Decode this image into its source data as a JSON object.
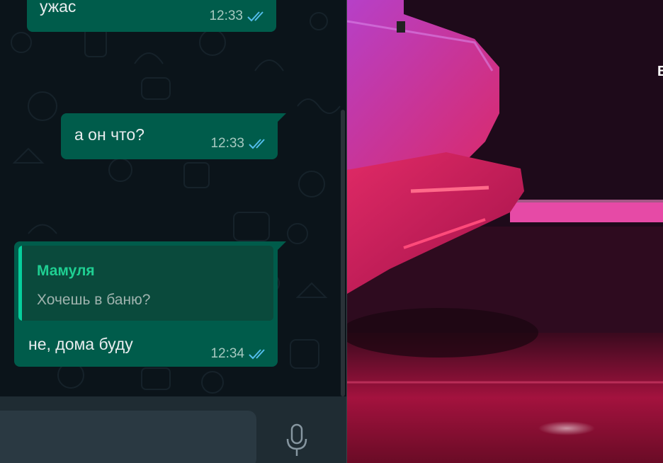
{
  "chat": {
    "messages": [
      {
        "text": "ужас",
        "time": "12:33",
        "status": "read"
      },
      {
        "text": "а он что?",
        "time": "12:33",
        "status": "read"
      },
      {
        "reply_to": {
          "author": "Мамуля",
          "text": "Хочешь в баню?"
        },
        "text": "не, дома буду",
        "time": "12:34",
        "status": "read"
      }
    ],
    "colors": {
      "outgoing_bubble": "#005c4b",
      "read_ticks": "#53bdeb",
      "quote_author": "#1fcf92"
    }
  },
  "composer": {
    "mic_icon": "microphone-icon"
  },
  "video": {
    "caption": "B"
  }
}
